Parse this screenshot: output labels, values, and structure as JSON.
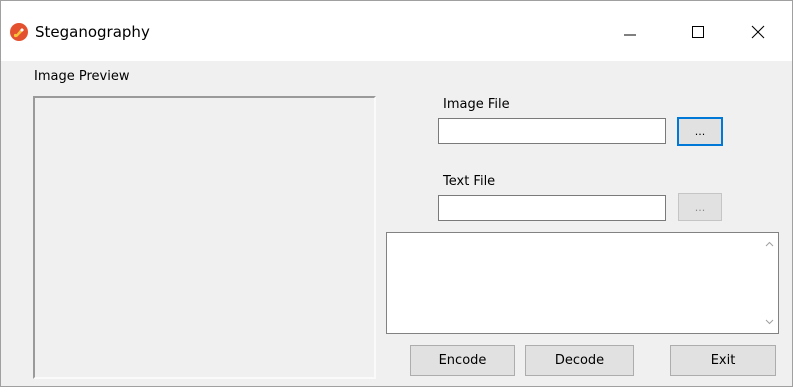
{
  "window": {
    "title": "Steganography",
    "icon": "paintbrush-icon",
    "controls": {
      "minimize_icon": "minimize-icon",
      "maximize_icon": "maximize-icon",
      "close_icon": "close-icon"
    }
  },
  "preview": {
    "label": "Image Preview"
  },
  "image_file": {
    "label": "Image File",
    "value": "",
    "browse_label": "..."
  },
  "text_file": {
    "label": "Text File",
    "value": "",
    "browse_label": "..."
  },
  "message_box": {
    "value": ""
  },
  "actions": {
    "encode_label": "Encode",
    "decode_label": "Decode",
    "exit_label": "Exit"
  },
  "colors": {
    "accent": "#0078d7",
    "window_bg": "#f0f0f0",
    "icon": "#e4512e"
  }
}
